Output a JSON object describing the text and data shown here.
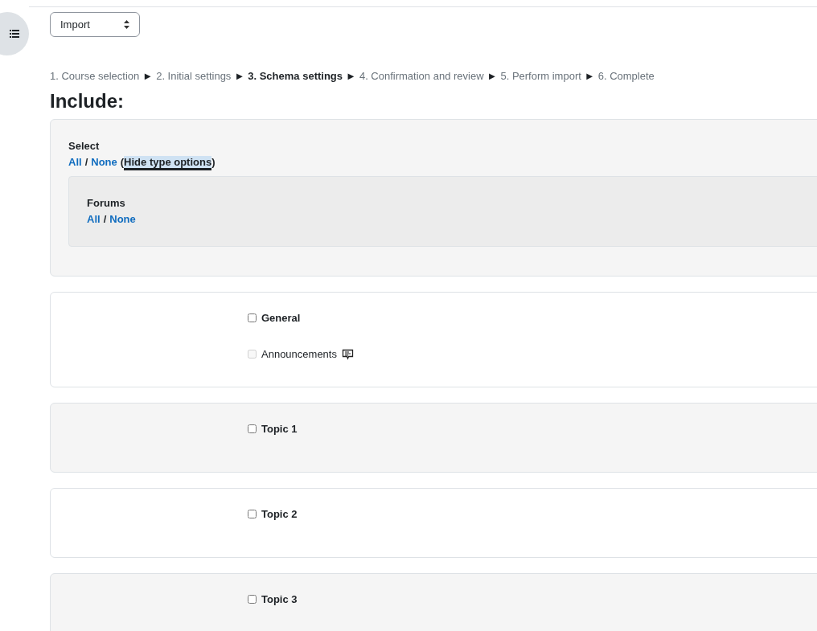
{
  "action_select": {
    "value": "Import"
  },
  "breadcrumb": {
    "separator": "►",
    "steps": [
      {
        "label": "1. Course selection",
        "current": false
      },
      {
        "label": "2. Initial settings",
        "current": false
      },
      {
        "label": "3. Schema settings",
        "current": true
      },
      {
        "label": "4. Confirmation and review",
        "current": false
      },
      {
        "label": "5. Perform import",
        "current": false
      },
      {
        "label": "6. Complete",
        "current": false
      }
    ]
  },
  "heading": "Include:",
  "select_panel": {
    "title": "Select",
    "all": "All",
    "slash": "/",
    "none": "None",
    "toggle_open": "(",
    "toggle": "Hide type options",
    "toggle_close": ")",
    "types": [
      {
        "title": "Forums",
        "all": "All",
        "slash": "/",
        "none": "None"
      }
    ]
  },
  "sections": [
    {
      "name": "General",
      "checked": false,
      "activities": [
        {
          "name": "Announcements",
          "checked": false,
          "disabled": true
        }
      ]
    },
    {
      "name": "Topic 1",
      "checked": false
    },
    {
      "name": "Topic 2",
      "checked": false
    },
    {
      "name": "Topic 3",
      "checked": false
    }
  ]
}
